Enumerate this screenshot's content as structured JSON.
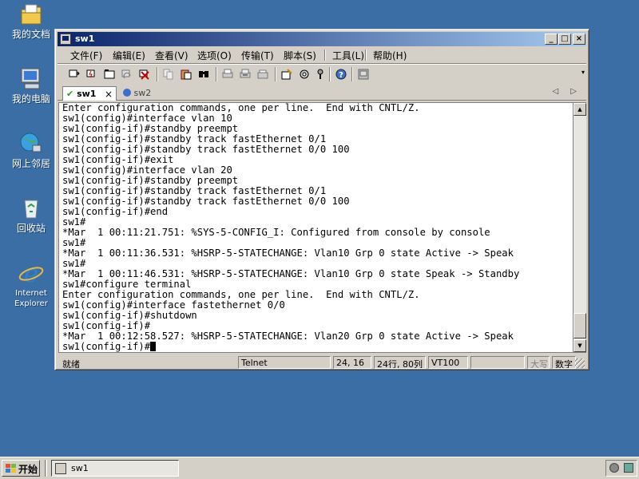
{
  "desktop": {
    "icons": [
      {
        "label": "我的文档",
        "icon": "my-documents-icon"
      },
      {
        "label": "我的电脑",
        "icon": "my-computer-icon"
      },
      {
        "label": "网上邻居",
        "icon": "network-places-icon"
      },
      {
        "label": "回收站",
        "icon": "recycle-bin-icon"
      },
      {
        "label": "Internet Explorer",
        "icon": "internet-explorer-icon"
      }
    ]
  },
  "window": {
    "title": "sw1",
    "controls": {
      "minimize": "_",
      "maximize": "□",
      "close": "×"
    }
  },
  "menu": [
    "文件(F)",
    "编辑(E)",
    "查看(V)",
    "选项(O)",
    "传输(T)",
    "脚本(S)",
    "工具(L)",
    "帮助(H)"
  ],
  "toolbar": {
    "icons": [
      "connect-icon",
      "quick-connect-icon",
      "connect-tab-icon",
      "reconnect-icon",
      "disconnect-icon",
      "copy-icon",
      "paste-icon",
      "find-icon",
      "print-icon",
      "print-selection-icon",
      "print-setup-icon",
      "session-options-icon",
      "global-options-icon",
      "keymap-icon",
      "help-icon",
      "sftp-icon"
    ]
  },
  "tabs": [
    {
      "label": "sw1",
      "active": true,
      "close": "×"
    },
    {
      "label": "sw2",
      "active": false
    }
  ],
  "tab_arrows": "◁ ▷",
  "terminal": {
    "lines": [
      "Enter configuration commands, one per line.  End with CNTL/Z.",
      "sw1(config)#interface vlan 10",
      "sw1(config-if)#standby preempt",
      "sw1(config-if)#standby track fastEthernet 0/1",
      "sw1(config-if)#standby track fastEthernet 0/0 100",
      "sw1(config-if)#exit",
      "sw1(config)#interface vlan 20",
      "sw1(config-if)#standby preempt",
      "sw1(config-if)#standby track fastEthernet 0/1",
      "sw1(config-if)#standby track fastEthernet 0/0 100",
      "sw1(config-if)#end",
      "sw1#",
      "*Mar  1 00:11:21.751: %SYS-5-CONFIG_I: Configured from console by console",
      "sw1#",
      "*Mar  1 00:11:36.531: %HSRP-5-STATECHANGE: Vlan10 Grp 0 state Active -> Speak",
      "sw1#",
      "*Mar  1 00:11:46.531: %HSRP-5-STATECHANGE: Vlan10 Grp 0 state Speak -> Standby",
      "sw1#configure terminal",
      "Enter configuration commands, one per line.  End with CNTL/Z.",
      "sw1(config)#interface fastethernet 0/0",
      "sw1(config-if)#shutdown",
      "sw1(config-if)#",
      "*Mar  1 00:12:58.527: %HSRP-5-STATECHANGE: Vlan20 Grp 0 state Active -> Speak"
    ],
    "prompt": "sw1(config-if)#"
  },
  "statusbar": {
    "ready": "就绪",
    "protocol": "Telnet",
    "cursor_pos": "24, 16",
    "size": "24行, 80列",
    "emulation": "VT100",
    "blank": "",
    "caps": "大写",
    "num": "数字"
  },
  "taskbar": {
    "start": "开始",
    "task": "sw1"
  }
}
